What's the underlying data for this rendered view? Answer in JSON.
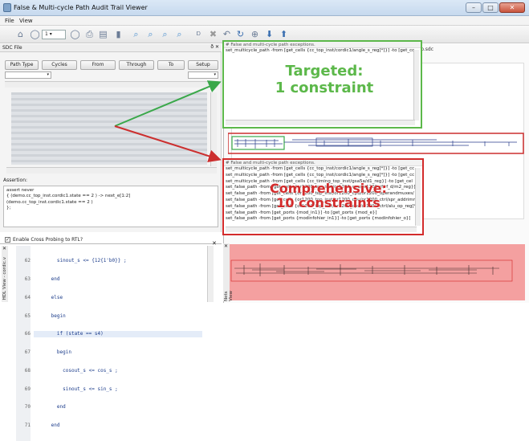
{
  "window": {
    "title": "False & Multi-cycle Path Audit Trail Viewer"
  },
  "menu": {
    "file": "File",
    "view": "View"
  },
  "toolbar": {
    "zoom_value": "1"
  },
  "sdc_panel": {
    "title": "SDC File",
    "columns": [
      "Path Type",
      "Cycles",
      "From",
      "Through",
      "To",
      "Setup"
    ]
  },
  "assertion": {
    "label": "Assertion:",
    "lines": [
      "assert never",
      "  { (demo.cc_top_inst.cordic1.state == 2 )  -> next_e[1:2]",
      "    (demo.cc_top_inst.cordic1.state == 2 )",
      "};"
    ]
  },
  "cross_probe": {
    "label": "Enable Cross Probing to RTL?"
  },
  "hdl": {
    "vtab": "HDL View - cordic.v",
    "line_numbers": [
      "62",
      "63",
      "64",
      "65",
      "66",
      "67",
      "68",
      "69",
      "70",
      "71"
    ],
    "lines": [
      "        sinout_s <= {12{1'b0}} ;",
      "      end",
      "      else",
      "      begin",
      "        if (state == s4)",
      "        begin",
      "          cosout_s <= cos_s ;",
      "          sinout_s <= sin_s ;",
      "        end",
      "      end"
    ]
  },
  "file_tab": "ults/demo.sdc",
  "schematic_vtab": "Nets View",
  "targeted": {
    "header": "# False and multi-cycle path exceptions.",
    "line": "set_multicycle_path -from [get_cells {cc_top_inst/cordic1/angle_s_reg[*]}] -to [get_cc",
    "big_line1": "Targeted:",
    "big_line2": "1 constraint",
    "color": "#5cb84a"
  },
  "comprehensive": {
    "header": "# False and multi-cycle path exceptions.",
    "lines": [
      "set_multicycle_path -from [get_cells {cc_top_inst/cordic1/angle_s_reg[*]}] -to [get_cc",
      "set_multicycle_path -from [get_cells {cc_top_inst/cordic1/angle_s_reg[*]}] -to [get_cc",
      "set_multicycle_path -from [get_cells {cc_timing_top_inst/gsa5a/d1_reg}] -to [get_cel",
      "set_false_path -from [get_cells {or1200_top_inst/or1200_cpu/or1200_rf/rf_d/m2_reg}]",
      "set_false_path -from [get_cells {or1200_top_inst/or1200_cpu/or1200_operandmuxes/",
      "set_false_path -from [get_cells {or1200_top_inst/or1200_cpu/or1200_ctrl/spr_addrimm",
      "set_false_path -from [get_cells {or1200_top_inst/or1200_cpu/or1200_ctrl/alu_op_reg[*",
      "set_false_path -from [get_ports {mod_in1}] -to [get_ports {mod_e}]",
      "set_false_path -from [get_ports {modinfohier_in1}] -to [get_ports {modinfohier_o}]"
    ],
    "big_line1": "Comprehensive:",
    "big_line2": "10 constraints",
    "color": "#d32b2b"
  },
  "colors": {
    "green_arrow": "#3aa84a",
    "red_arrow": "#cc2f2f",
    "red_highlight": "#f4a0a0"
  }
}
